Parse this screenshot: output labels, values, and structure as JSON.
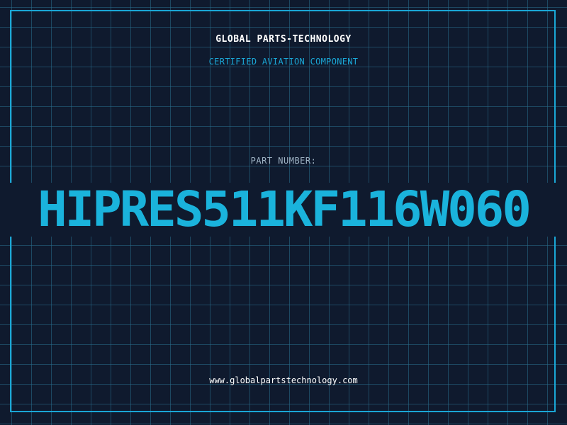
{
  "header": {
    "company": "GLOBAL PARTS-TECHNOLOGY",
    "subtitle": "CERTIFIED AVIATION COMPONENT"
  },
  "part": {
    "label": "PART NUMBER:",
    "number": "HIPRES511KF116W060"
  },
  "footer": {
    "website": "www.globalpartstechnology.com"
  },
  "colors": {
    "background": "#0f1a2e",
    "grid": "#286e8c",
    "accent": "#1aa7d6",
    "part_number": "#1ab3dc",
    "text": "#ffffff",
    "label": "#9fb3c4"
  }
}
